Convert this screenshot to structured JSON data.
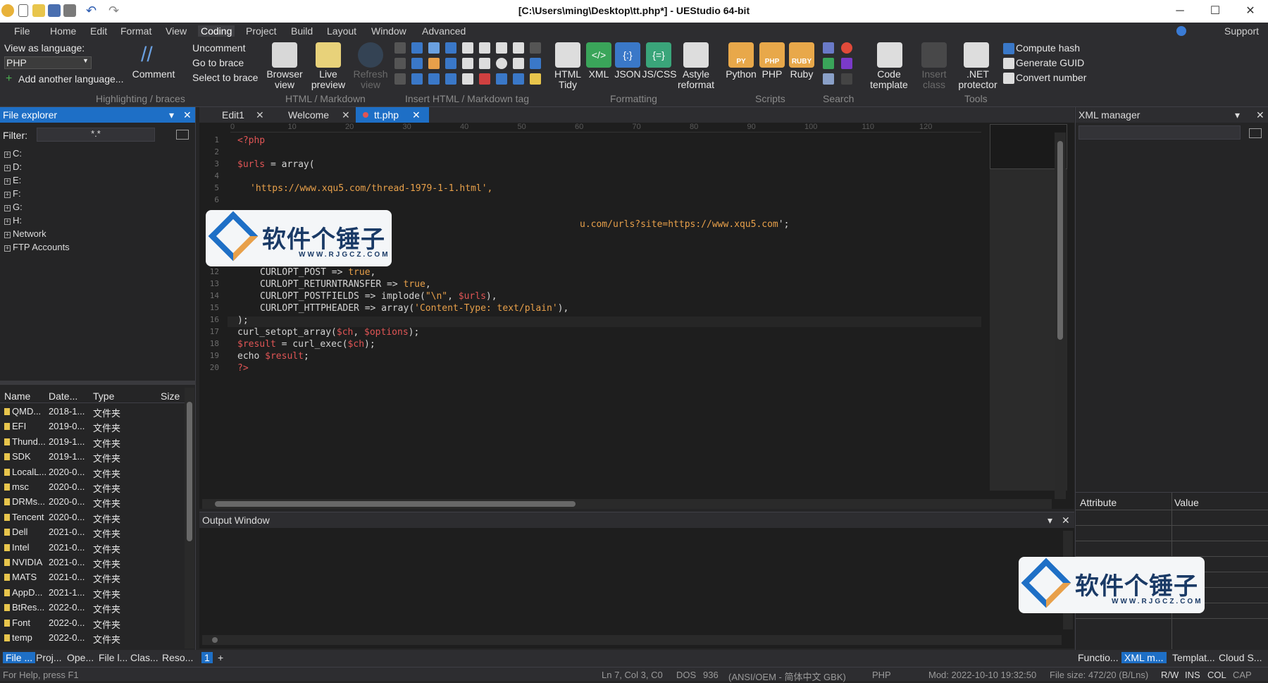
{
  "window": {
    "title": "[C:\\Users\\ming\\Desktop\\tt.php*] - UEStudio 64-bit"
  },
  "menu": [
    "File",
    "Home",
    "Edit",
    "Format",
    "View",
    "Coding",
    "Project",
    "Build",
    "Layout",
    "Window",
    "Advanced"
  ],
  "menu_active": "Coding",
  "support_label": "Support",
  "ribbon": {
    "view_as_language": "View as language:",
    "language_value": "PHP",
    "add_language": "Add another language...",
    "comment": "Comment",
    "uncomment": "Uncomment",
    "go_to_brace": "Go to brace",
    "select_to_brace": "Select to brace",
    "group_highlighting": "Highlighting / braces",
    "browser_view": [
      "Browser",
      "view"
    ],
    "live_preview": [
      "Live",
      "preview"
    ],
    "refresh_view": [
      "Refresh",
      "view"
    ],
    "group_html_markdown": "HTML / Markdown",
    "group_insert_html": "Insert HTML / Markdown tag",
    "html_tidy": [
      "HTML",
      "Tidy"
    ],
    "xml": "XML",
    "json": "JSON",
    "jscss": "JS/CSS",
    "astyle": [
      "Astyle",
      "reformat"
    ],
    "group_formatting": "Formatting",
    "python": "Python",
    "php": "PHP",
    "ruby": "Ruby",
    "group_scripts": "Scripts",
    "group_search": "Search",
    "code_template": [
      "Code",
      "template"
    ],
    "insert_class": [
      "Insert",
      "class"
    ],
    "net_protector": [
      ".NET",
      "protector"
    ],
    "group_tools": "Tools",
    "compute_hash": "Compute hash",
    "generate_guid": "Generate GUID",
    "convert_number": "Convert number",
    "icon_py": "PY",
    "icon_php": "PHP",
    "icon_ruby": "RUBY"
  },
  "file_explorer": {
    "title": "File explorer",
    "filter_label": "Filter:",
    "filter_value": "*.*",
    "drives": [
      "C:",
      "D:",
      "E:",
      "F:",
      "G:",
      "H:",
      "Network",
      "FTP Accounts"
    ],
    "columns": [
      "Name",
      "Date...",
      "Type",
      "Size"
    ],
    "rows": [
      [
        "QMD...",
        "2018-1...",
        "文件夹"
      ],
      [
        "EFI",
        "2019-0...",
        "文件夹"
      ],
      [
        "Thund...",
        "2019-1...",
        "文件夹"
      ],
      [
        "SDK",
        "2019-1...",
        "文件夹"
      ],
      [
        "LocalL...",
        "2020-0...",
        "文件夹"
      ],
      [
        "msc",
        "2020-0...",
        "文件夹"
      ],
      [
        "DRMs...",
        "2020-0...",
        "文件夹"
      ],
      [
        "Tencent",
        "2020-0...",
        "文件夹"
      ],
      [
        "Dell",
        "2021-0...",
        "文件夹"
      ],
      [
        "Intel",
        "2021-0...",
        "文件夹"
      ],
      [
        "NVIDIA",
        "2021-0...",
        "文件夹"
      ],
      [
        "MATS",
        "2021-0...",
        "文件夹"
      ],
      [
        "AppD...",
        "2021-1...",
        "文件夹"
      ],
      [
        "BtRes...",
        "2022-0...",
        "文件夹"
      ],
      [
        "Font",
        "2022-0...",
        "文件夹"
      ],
      [
        "temp",
        "2022-0...",
        "文件夹"
      ]
    ]
  },
  "editor": {
    "tabs": [
      "Edit1",
      "Welcome",
      "tt.php"
    ],
    "active_tab": "tt.php",
    "ruler": [
      "0",
      "10",
      "20",
      "30",
      "40",
      "50",
      "60",
      "70",
      "80",
      "90",
      "100",
      "110",
      "120"
    ],
    "line_numbers": [
      "1",
      "2",
      "3",
      "4",
      "5",
      "6",
      "12",
      "13",
      "14",
      "15",
      "16",
      "17",
      "18",
      "19",
      "20"
    ],
    "code": {
      "l1": "<?php",
      "l3a": "$urls",
      "l3b": " = array(",
      "l4": "'https://www.xqu5.com/thread-1979-1-1.html',",
      "l7a": "u.com/urls?site=https://www.xqu5.com",
      "l7b": "';",
      "l12a": "CURLOPT_POST => ",
      "l12b": "true",
      "l12c": ",",
      "l13a": "CURLOPT_RETURNTRANSFER => ",
      "l13b": "true",
      "l13c": ",",
      "l14a": "CURLOPT_POSTFIELDS => implode(",
      "l14b": "\"\\n\"",
      "l14c": ", ",
      "l14d": "$urls",
      "l14e": "),",
      "l15a": "CURLOPT_HTTPHEADER => array(",
      "l15b": "'Content-Type: text/plain'",
      "l15c": "),",
      "l16": ");",
      "l17a": "curl_setopt_array(",
      "l17b": "$ch",
      "l17c": ", ",
      "l17d": "$options",
      "l17e": ");",
      "l18a": "$result",
      "l18b": " = curl_exec(",
      "l18c": "$ch",
      "l18d": ");",
      "l19a": "echo ",
      "l19b": "$result",
      "l19c": ";",
      "l20": "?>"
    }
  },
  "output_window": {
    "title": "Output Window"
  },
  "xml_manager": {
    "title": "XML manager",
    "columns": [
      "Attribute",
      "Value"
    ]
  },
  "bottom_tabs_left": [
    "File ...",
    "Proj...",
    "Ope...",
    "File l...",
    "Clas...",
    "Reso..."
  ],
  "bottom_tab_page": "1",
  "bottom_tab_add": "+",
  "bottom_tabs_right": [
    "Functio...",
    "XML m...",
    "Templat...",
    "Cloud S..."
  ],
  "status": {
    "help": "For Help, press F1",
    "position": "Ln 7, Col 3, C0",
    "line_ending": "DOS",
    "codepage": "936",
    "encoding": "(ANSI/OEM - 简体中文 GBK)",
    "language": "PHP",
    "modified": "Mod: 2022-10-10 19:32:50",
    "file_size": "File size: 472/20 (B/Lns)",
    "rw": "R/W",
    "ins": "INS",
    "col": "COL",
    "cap": "CAP"
  },
  "watermark": {
    "text": "软件个锤子",
    "sub": "WWW.RJGCZ.COM"
  },
  "colors": {
    "accent": "#1e6fc6",
    "keyword": "#e05555",
    "string": "#e8a04a"
  }
}
